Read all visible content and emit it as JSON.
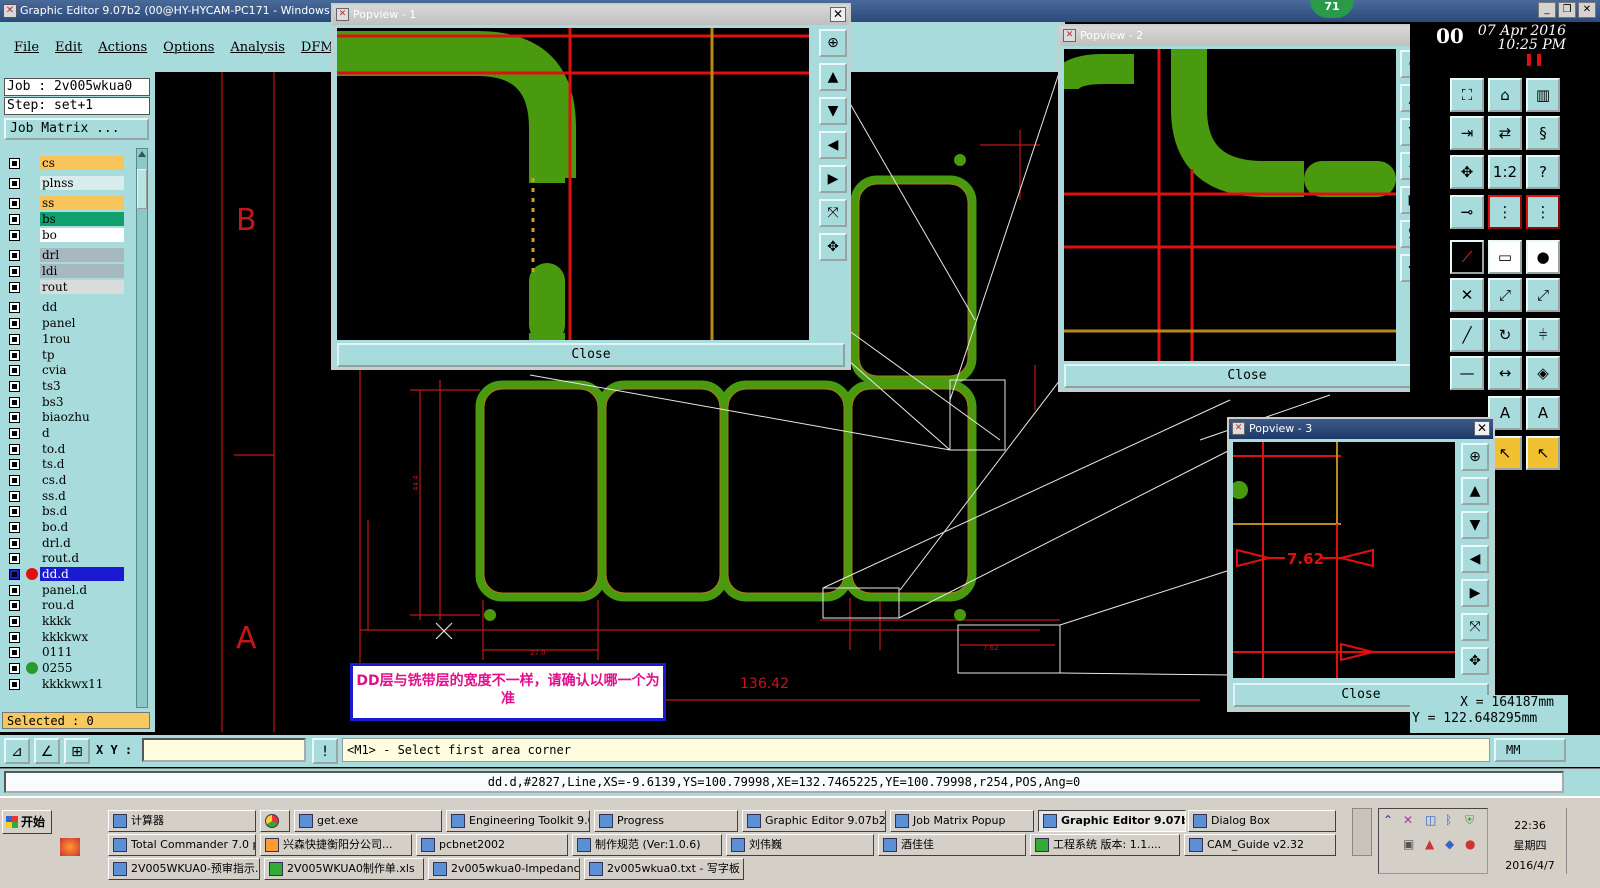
{
  "app": {
    "title": "Graphic Editor 9.07b2 (00@HY-HYCAM-PC171 - Windows"
  },
  "menu": [
    "File",
    "Edit",
    "Actions",
    "Options",
    "Analysis",
    "DFM"
  ],
  "job": {
    "job_line": "Job : 2v005wkua0",
    "step_line": "Step: set+1",
    "job_matrix": "Job Matrix ..."
  },
  "layers": [
    {
      "name": "cs",
      "color": "#f8c45c"
    },
    {
      "name": "plnss",
      "color": "#d8ecec"
    },
    {
      "name": "ss",
      "color": "#f8c45c"
    },
    {
      "name": "bs",
      "color": "#10a070"
    },
    {
      "name": "bo",
      "color": "#ffffff"
    },
    {
      "name": "drl",
      "color": "#a8b8c0"
    },
    {
      "name": "ldi",
      "color": "#a8b8c0"
    },
    {
      "name": "rout",
      "color": "#d8dcdc"
    },
    {
      "name": "dd",
      "color": "#a8dcdc"
    },
    {
      "name": "panel",
      "color": "#a8dcdc"
    },
    {
      "name": "1rou",
      "color": "#a8dcdc"
    },
    {
      "name": "tp",
      "color": "#a8dcdc"
    },
    {
      "name": "cvia",
      "color": "#a8dcdc"
    },
    {
      "name": "ts3",
      "color": "#a8dcdc"
    },
    {
      "name": "bs3",
      "color": "#a8dcdc"
    },
    {
      "name": "biaozhu",
      "color": "#a8dcdc"
    },
    {
      "name": "d",
      "color": "#a8dcdc"
    },
    {
      "name": "to.d",
      "color": "#a8dcdc"
    },
    {
      "name": "ts.d",
      "color": "#a8dcdc"
    },
    {
      "name": "cs.d",
      "color": "#a8dcdc"
    },
    {
      "name": "ss.d",
      "color": "#a8dcdc"
    },
    {
      "name": "bs.d",
      "color": "#a8dcdc"
    },
    {
      "name": "bo.d",
      "color": "#a8dcdc"
    },
    {
      "name": "drl.d",
      "color": "#a8dcdc"
    },
    {
      "name": "rout.d",
      "color": "#a8dcdc"
    },
    {
      "name": "dd.d",
      "color": "#a8dcdc"
    },
    {
      "name": "panel.d",
      "color": "#a8dcdc"
    },
    {
      "name": "rou.d",
      "color": "#a8dcdc"
    },
    {
      "name": "kkkk",
      "color": "#a8dcdc"
    },
    {
      "name": "kkkkwx",
      "color": "#a8dcdc"
    },
    {
      "name": "0111",
      "color": "#a8dcdc"
    },
    {
      "name": "0255",
      "color": "#a8dcdc"
    },
    {
      "name": "kkkkwx11",
      "color": "#a8dcdc"
    }
  ],
  "selected": "Selected : 0",
  "canvas": {
    "label_b": "B",
    "label_a": "A",
    "dim_main": "136.42",
    "dim_small": "27.0",
    "dim_vert": "44.4",
    "dim_762": "7.62"
  },
  "popups": {
    "p1": {
      "title": "Popview - 1",
      "close": "Close"
    },
    "p2": {
      "title": "Popview - 2",
      "close": "Close"
    },
    "p3": {
      "title": "Popview - 3",
      "close": "Close",
      "measure": "7.62"
    }
  },
  "header_right": {
    "counter": "71",
    "partial_num": "00",
    "date": "07 Apr 2016",
    "time": "10:25 PM"
  },
  "coords": {
    "x": "X = 164187mm",
    "y": "Y = 122.648295mm"
  },
  "command": {
    "xy_label": "X Y :",
    "prompt": "<M1> - Select first area corner",
    "unit": "MM"
  },
  "status": "dd.d,#2827,Line,XS=-9.6139,YS=100.79998,XE=132.7465225,YE=100.79998,r254,POS,Ang=0",
  "message": "DD层与铣带层的宽度不一样，请确认以哪一个为准",
  "taskbar": {
    "start": "开始",
    "row1": [
      "计算器",
      "",
      "get.exe",
      "Engineering Toolkit 9.0...",
      "Progress",
      "Graphic Editor 9.07b2 (...",
      "Job Matrix Popup",
      "Graphic Editor 9.07b...",
      "Dialog Box"
    ],
    "row2": [
      "Total Commander 7.0 p...",
      "兴森快捷衡阳分公司...",
      "pcbnet2002",
      "制作规范 (Ver:1.0.6)",
      "刘伟巍",
      "酒佳佳",
      "工程系统  版本: 1.1....",
      "CAM_Guide v2.32"
    ],
    "row3": [
      "2V005WKUA0-预审指示...",
      "2V005WKUA0制作单.xls",
      "2v005wkua0-Impedance...",
      "2v005wkua0.txt - 写字板"
    ],
    "clock": "22:36",
    "weekday": "星期四",
    "date": "2016/4/7"
  }
}
